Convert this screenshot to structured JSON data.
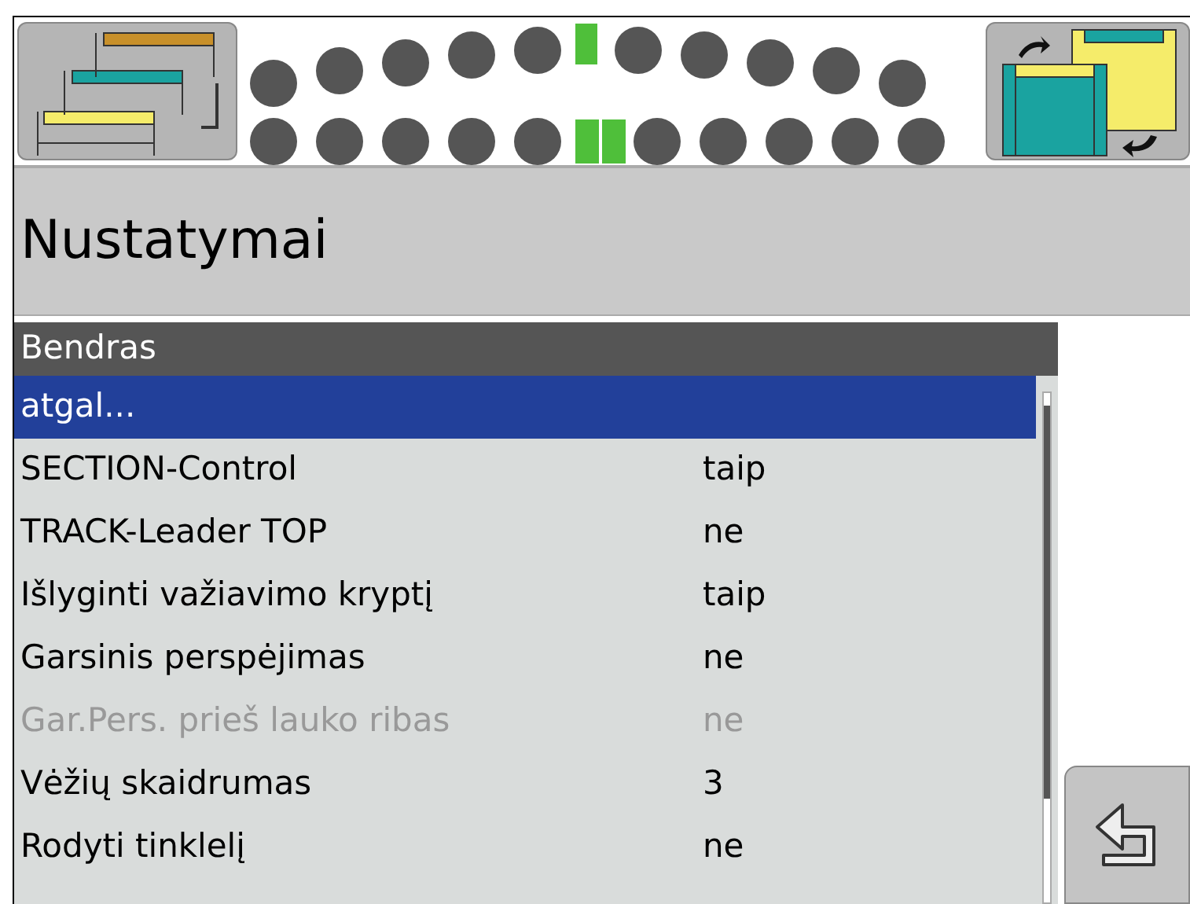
{
  "title": "Nustatymai",
  "section_status": {
    "top_active": [
      false,
      false,
      false,
      false,
      false,
      true,
      false,
      false,
      false,
      false,
      false
    ],
    "bottom_active": [
      false,
      false,
      false,
      false,
      false,
      true,
      true,
      false,
      false,
      false,
      false,
      false
    ]
  },
  "list": {
    "header": "Bendras",
    "rows": [
      {
        "label": "atgal...",
        "selected": true,
        "disabled": false
      },
      {
        "label": "SECTION-Control",
        "value": "taip",
        "selected": false,
        "disabled": false
      },
      {
        "label": "TRACK-Leader TOP",
        "value": "ne",
        "selected": false,
        "disabled": false
      },
      {
        "label": "Išlyginti važiavimo kryptį",
        "value": "taip",
        "selected": false,
        "disabled": false
      },
      {
        "label": "Garsinis perspėjimas",
        "value": "ne",
        "selected": false,
        "disabled": false
      },
      {
        "label": "Gar.Pers. prieš lauko ribas",
        "value": "ne",
        "selected": false,
        "disabled": true
      },
      {
        "label": "Vėžių skaidrumas",
        "value": "3",
        "selected": false,
        "disabled": false
      },
      {
        "label": "Rodyti tinklelį",
        "value": "ne",
        "selected": false,
        "disabled": false
      }
    ]
  }
}
